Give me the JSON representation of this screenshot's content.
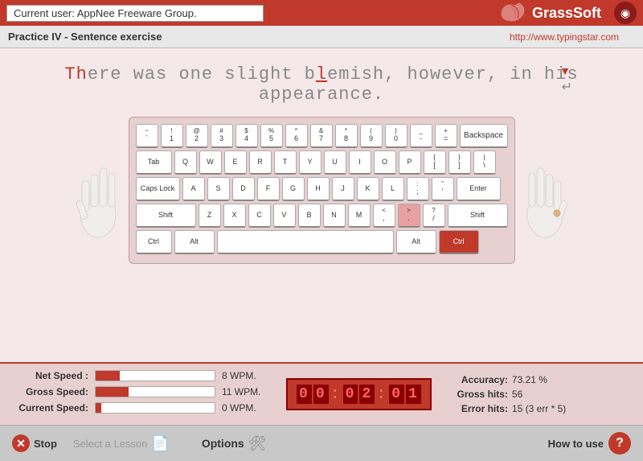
{
  "header": {
    "user_label": "Current user: AppNee Freeware Group.",
    "logo": "GrassSoft",
    "url": "http://www.typingstar.com"
  },
  "subheader": {
    "title": "Practice IV - Sentence exercise",
    "url": "http://www.typingstar.com"
  },
  "sentence": {
    "typed_part": "Th",
    "remaining": "ere was one slight b",
    "error_char": "l",
    "rest": "emish, however, in his appearance."
  },
  "stats": {
    "net_speed_label": "Net Speed :",
    "net_speed_value": "8 WPM.",
    "net_speed_bar": 20,
    "gross_speed_label": "Gross Speed:",
    "gross_speed_value": "11 WPM.",
    "gross_speed_bar": 28,
    "current_speed_label": "Current Speed:",
    "current_speed_value": "0 WPM.",
    "current_speed_bar": 5,
    "timer": "00:02:01",
    "accuracy_label": "Accuracy:",
    "accuracy_value": "73.21 %",
    "gross_hits_label": "Gross hits:",
    "gross_hits_value": "56",
    "error_hits_label": "Error hits:",
    "error_hits_value": "15 (3 err * 5)"
  },
  "footer": {
    "stop_label": "Stop",
    "select_lesson_label": "Select a Lesson",
    "options_label": "Options",
    "how_to_use_label": "How to use"
  },
  "keyboard": {
    "rows": [
      [
        "~\n`",
        "!\n1",
        "@\n2",
        "#\n3",
        "$\n4",
        "%\n5",
        "^\n6",
        "&\n7",
        "*\n8",
        "(\n9",
        ")\n0",
        "_\n-",
        "+\n=",
        "Backspace"
      ],
      [
        "Tab",
        "Q",
        "W",
        "E",
        "R",
        "T",
        "Y",
        "U",
        "I",
        "O",
        "P",
        "{\n[",
        "}\n]",
        "|\n\\"
      ],
      [
        "Caps Lock",
        "A",
        "S",
        "D",
        "F",
        "G",
        "H",
        "J",
        "K",
        "L",
        ":\n;",
        "\"\n'",
        "Enter"
      ],
      [
        "Shift",
        "Z",
        "X",
        "C",
        "V",
        "B",
        "N",
        "M",
        "<\n,",
        ">\n.",
        "?\n/",
        "Shift"
      ],
      [
        "Ctrl",
        "Alt",
        "",
        "Alt",
        "Ctrl"
      ]
    ]
  }
}
